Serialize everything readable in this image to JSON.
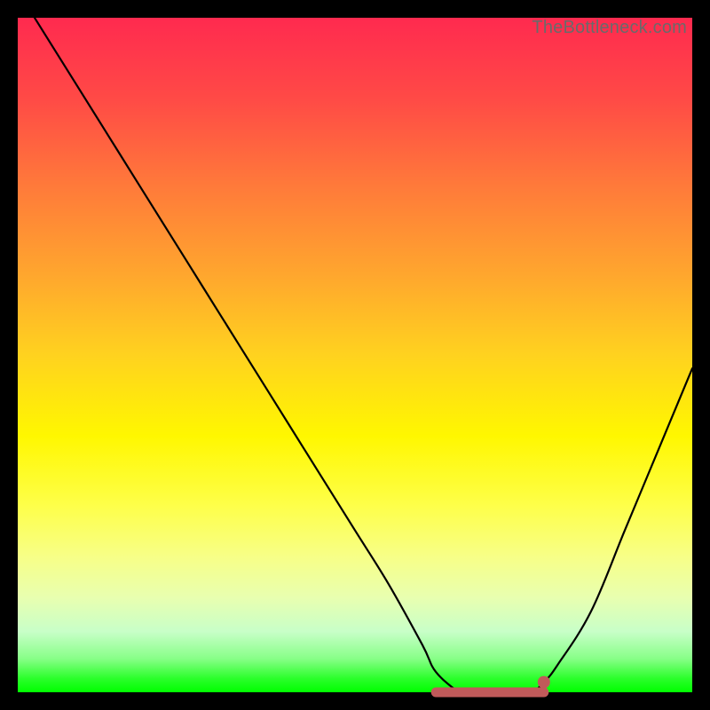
{
  "attribution": "TheBottleneck.com",
  "chart_data": {
    "type": "line",
    "title": "",
    "xlabel": "",
    "ylabel": "",
    "xlim": [
      0,
      100
    ],
    "ylim": [
      0,
      100
    ],
    "series": [
      {
        "name": "bottleneck-curve",
        "x": [
          0,
          5,
          10,
          15,
          20,
          25,
          30,
          35,
          40,
          45,
          50,
          55,
          60,
          62,
          65.5,
          67,
          72,
          76,
          78,
          80,
          85,
          90,
          95,
          100
        ],
        "y": [
          104,
          96,
          88,
          80,
          72,
          64,
          56,
          48,
          40,
          32,
          24,
          16,
          7,
          3,
          0,
          0,
          0,
          0,
          1.5,
          4,
          12,
          24,
          36,
          48
        ]
      }
    ],
    "flat_segment": {
      "x_start": 62,
      "x_end": 78,
      "y": 0,
      "color": "#c05a5a"
    },
    "end_dot": {
      "x": 78,
      "y": 1.5,
      "color": "#c05a5a"
    },
    "gradient_stops": [
      {
        "pct": 0,
        "color": "#ff2a4f"
      },
      {
        "pct": 12,
        "color": "#ff4a46"
      },
      {
        "pct": 25,
        "color": "#ff7a3a"
      },
      {
        "pct": 38,
        "color": "#ffa62e"
      },
      {
        "pct": 50,
        "color": "#ffd21f"
      },
      {
        "pct": 62,
        "color": "#fff700"
      },
      {
        "pct": 72,
        "color": "#feff47"
      },
      {
        "pct": 80,
        "color": "#f7ff88"
      },
      {
        "pct": 86,
        "color": "#e8ffb0"
      },
      {
        "pct": 91,
        "color": "#c8ffc8"
      },
      {
        "pct": 95,
        "color": "#88ff88"
      },
      {
        "pct": 98,
        "color": "#2aff2a"
      },
      {
        "pct": 100,
        "color": "#00ff00"
      }
    ]
  }
}
